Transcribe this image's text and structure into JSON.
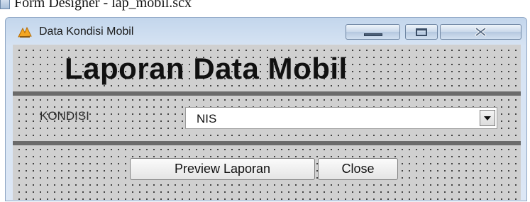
{
  "designer": {
    "title": "Form Designer - lap_mobil.scx"
  },
  "window": {
    "title": "Data Kondisi Mobil",
    "icon": "app-icon",
    "controls": {
      "minimize_icon": "minimize-icon",
      "maximize_icon": "maximize-icon",
      "close_icon": "close-icon"
    }
  },
  "form": {
    "heading": "Laporan Data Mobil",
    "kondisi_label": "KONDISI",
    "kondisi_select": {
      "value": "NIS",
      "arrow_icon": "chevron-down-icon"
    },
    "buttons": {
      "preview": "Preview Laporan",
      "close": "Close"
    }
  },
  "colors": {
    "form_background": "#d0d0d0",
    "grid_dots": "#2b2b2b",
    "rule": "#6b6b6b",
    "window_frame": "#c3d6ec"
  }
}
